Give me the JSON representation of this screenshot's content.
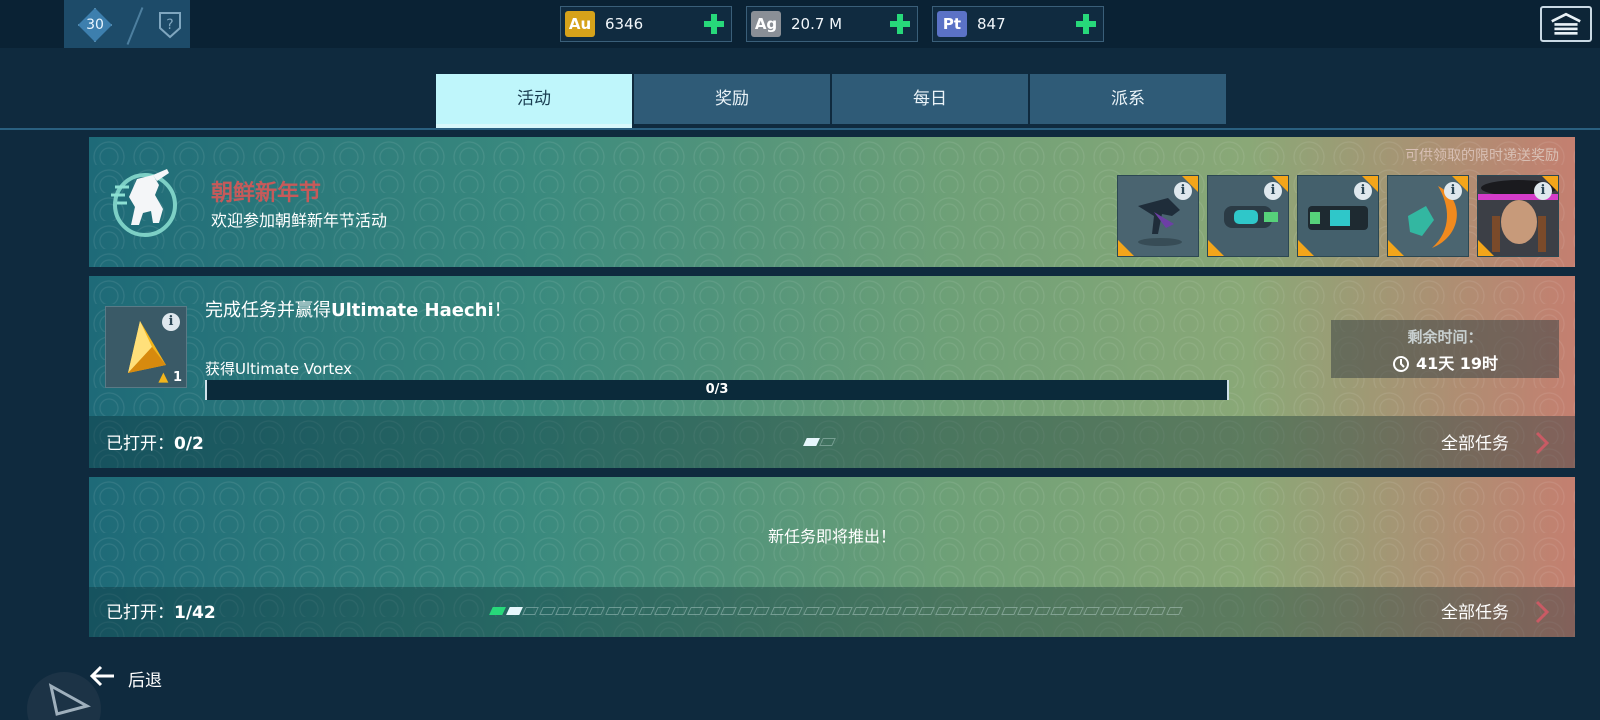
{
  "player": {
    "level": "30"
  },
  "currencies": [
    {
      "code": "Au",
      "value": "6346",
      "color": "#d6a21a"
    },
    {
      "code": "Ag",
      "value": "20.7 M",
      "color": "#8a8f96"
    },
    {
      "code": "Pt",
      "value": "847",
      "color": "#5b72c6"
    }
  ],
  "tabs": [
    {
      "label": "活动",
      "active": true
    },
    {
      "label": "奖励",
      "active": false
    },
    {
      "label": "每日",
      "active": false
    },
    {
      "label": "派系",
      "active": false
    }
  ],
  "event": {
    "title": "朝鲜新年节",
    "subtitle": "欢迎参加朝鲜新年节活动",
    "rewards_caption": "可供领取的限时递送奖励",
    "rewards": [
      {
        "icon": "robot-reward-icon"
      },
      {
        "icon": "weapon-reward-icon"
      },
      {
        "icon": "cannon-reward-icon"
      },
      {
        "icon": "drone-reward-icon"
      },
      {
        "icon": "pilot-reward-icon"
      }
    ]
  },
  "task": {
    "title_prefix": "完成任务并赢得",
    "title_bold": "Ultimate Haechi",
    "title_suffix": "！",
    "requirement": "获得Ultimate Vortex",
    "progress_text": "0/3",
    "progress_fraction": 0,
    "icon_qty": "1",
    "timer_label": "剩余时间：",
    "timer_value": "41天 19时",
    "opened_label": "已打开：",
    "opened_value": "0/2",
    "all_tasks": "全部任务",
    "page_dots": 2,
    "page_dots_filled": 1
  },
  "upcoming": {
    "message": "新任务即将推出！",
    "opened_label": "已打开：",
    "opened_value": "1/42",
    "all_tasks": "全部任务",
    "page_dots": 42,
    "page_dots_filled": 1
  },
  "footer": {
    "back_label": "后退"
  }
}
